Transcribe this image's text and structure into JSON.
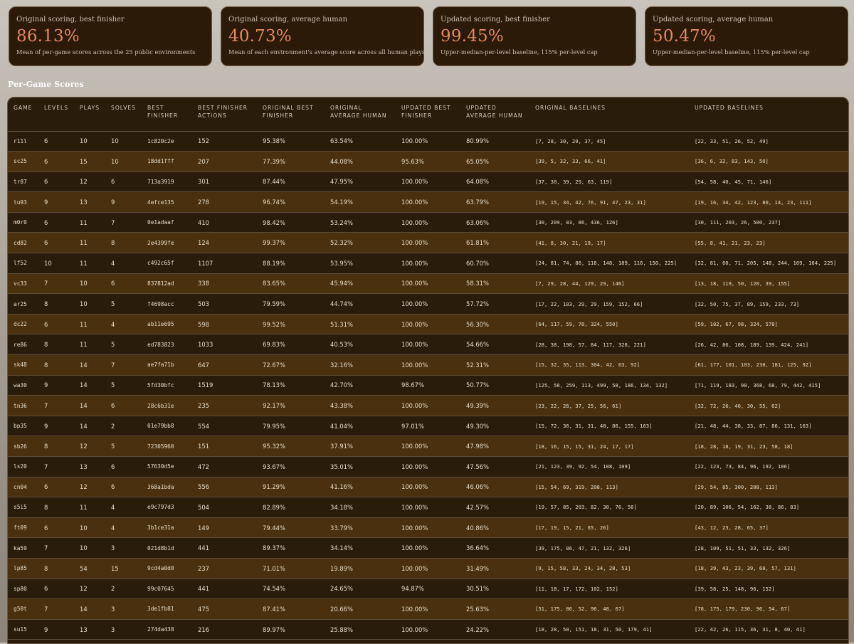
{
  "summary_cards": [
    {
      "label": "Original scoring, best finisher",
      "value": "86.13%",
      "description": "Mean of per-game scores across the 25 public environments"
    },
    {
      "label": "Original scoring, average human",
      "value": "40.73%",
      "description": "Mean of each environment's average score across all human plays"
    },
    {
      "label": "Updated scoring, best finisher",
      "value": "99.45%",
      "description": "Upper-median-per-level baseline, 115% per-level cap"
    },
    {
      "label": "Updated scoring, average human",
      "value": "50.47%",
      "description": "Upper-median-per-level baseline, 115% per-level cap"
    }
  ],
  "section_title": "Per-Game Scores",
  "table": {
    "headers": [
      "GAME",
      "LEVELS",
      "PLAYS",
      "SOLVES",
      "BEST FINISHER",
      "BEST FINISHER ACTIONS",
      "ORIGINAL BEST FINISHER",
      "ORIGINAL AVERAGE HUMAN",
      "UPDATED BEST FINISHER",
      "UPDATED AVERAGE HUMAN",
      "ORIGINAL BASELINES",
      "UPDATED BASELINES"
    ],
    "rows": [
      [
        "r11l",
        "6",
        "10",
        "10",
        "1c820c2e",
        "152",
        "95.38%",
        "63.54%",
        "100.00%",
        "80.99%",
        "[7, 28, 30, 20, 37, 45]",
        "[22, 33, 51, 26, 52, 49]"
      ],
      [
        "sc25",
        "6",
        "15",
        "10",
        "18dd1fff",
        "207",
        "77.39%",
        "44.08%",
        "95.63%",
        "65.05%",
        "[39, 5, 32, 33, 66, 41]",
        "[36, 6, 32, 83, 143, 50]"
      ],
      [
        "tr87",
        "6",
        "12",
        "6",
        "713a3919",
        "301",
        "87.44%",
        "47.95%",
        "100.00%",
        "64.08%",
        "[37, 30, 39, 29, 63, 119]",
        "[54, 58, 40, 45, 71, 146]"
      ],
      [
        "tu93",
        "9",
        "13",
        "9",
        "4efce135",
        "278",
        "96.74%",
        "54.19%",
        "100.00%",
        "63.79%",
        "[19, 15, 34, 42, 76, 91, 47, 23, 31]",
        "[19, 16, 34, 42, 123, 80, 14, 23, 111]"
      ],
      [
        "m0r0",
        "6",
        "11",
        "7",
        "0e1adaaf",
        "410",
        "98.42%",
        "53.24%",
        "100.00%",
        "63.06%",
        "[30, 209, 83, 86, 436, 126]",
        "[30, 111, 203, 26, 500, 237]"
      ],
      [
        "cd82",
        "6",
        "11",
        "8",
        "2e4399fe",
        "124",
        "99.37%",
        "52.32%",
        "100.00%",
        "61.81%",
        "[41, 8, 30, 21, 19, 17]",
        "[55, 8, 41, 21, 23, 23]"
      ],
      [
        "lf52",
        "10",
        "11",
        "4",
        "c492c65f",
        "1107",
        "88.19%",
        "53.95%",
        "100.00%",
        "60.70%",
        "[24, 81, 74, 86, 118, 148, 189, 116, 150, 225]",
        "[32, 81, 60, 71, 205, 148, 244, 109, 164, 225]"
      ],
      [
        "vc33",
        "7",
        "10",
        "6",
        "837812ad",
        "338",
        "83.65%",
        "45.94%",
        "100.00%",
        "58.31%",
        "[7, 29, 28, 44, 129, 29, 146]",
        "[13, 18, 119, 50, 120, 39, 155]"
      ],
      [
        "ar25",
        "8",
        "10",
        "5",
        "f4698acc",
        "503",
        "79.59%",
        "44.74%",
        "100.00%",
        "57.72%",
        "[17, 22, 103, 29, 29, 159, 152, 66]",
        "[32, 50, 75, 37, 89, 159, 233, 73]"
      ],
      [
        "dc22",
        "6",
        "11",
        "4",
        "ab11e695",
        "598",
        "99.52%",
        "51.31%",
        "100.00%",
        "56.30%",
        "[64, 117, 59, 78, 324, 550]",
        "[59, 102, 67, 98, 324, 578]"
      ],
      [
        "re86",
        "8",
        "11",
        "5",
        "ed783823",
        "1033",
        "69.83%",
        "40.53%",
        "100.00%",
        "54.66%",
        "[28, 38, 198, 57, 84, 117, 328, 221]",
        "[26, 42, 86, 108, 189, 139, 424, 241]"
      ],
      [
        "sk48",
        "8",
        "14",
        "7",
        "ae7fa71b",
        "647",
        "72.67%",
        "32.16%",
        "100.00%",
        "52.31%",
        "[15, 32, 35, 113, 304, 42, 63, 92]",
        "[61, 177, 101, 103, 230, 181, 125, 92]"
      ],
      [
        "wa30",
        "9",
        "14",
        "5",
        "5fd30bfc",
        "1519",
        "78.13%",
        "42.70%",
        "98.67%",
        "50.77%",
        "[125, 58, 259, 113, 499, 58, 186, 134, 132]",
        "[71, 119, 183, 98, 368, 68, 79, 442, 415]"
      ],
      [
        "tn36",
        "7",
        "14",
        "6",
        "28c6b31e",
        "235",
        "92.17%",
        "43.38%",
        "100.00%",
        "49.39%",
        "[23, 22, 26, 37, 25, 56, 61]",
        "[32, 72, 26, 40, 30, 55, 62]"
      ],
      [
        "bp35",
        "9",
        "14",
        "2",
        "01e79bb8",
        "554",
        "79.95%",
        "41.04%",
        "97.01%",
        "49.30%",
        "[15, 72, 36, 31, 31, 48, 86, 155, 163]",
        "[21, 48, 44, 38, 33, 87, 86, 131, 163]"
      ],
      [
        "sb26",
        "8",
        "12",
        "5",
        "72305960",
        "151",
        "95.32%",
        "37.91%",
        "100.00%",
        "47.98%",
        "[18, 16, 15, 15, 31, 24, 17, 17]",
        "[18, 28, 18, 19, 31, 23, 58, 18]"
      ],
      [
        "ls20",
        "7",
        "13",
        "6",
        "57630d5e",
        "472",
        "93.67%",
        "35.01%",
        "100.00%",
        "47.56%",
        "[21, 123, 39, 92, 54, 108, 109]",
        "[22, 123, 73, 84, 96, 192, 186]"
      ],
      [
        "cn04",
        "6",
        "12",
        "6",
        "368a1bda",
        "556",
        "91.29%",
        "41.16%",
        "100.00%",
        "46.06%",
        "[15, 54, 69, 319, 208, 113]",
        "[29, 54, 85, 300, 208, 113]"
      ],
      [
        "s5i5",
        "8",
        "11",
        "4",
        "e9c797d3",
        "504",
        "82.89%",
        "34.18%",
        "100.00%",
        "42.57%",
        "[19, 57, 85, 203, 82, 30, 76, 56]",
        "[20, 89, 106, 54, 162, 38, 86, 83]"
      ],
      [
        "ft09",
        "6",
        "10",
        "4",
        "3b1ce31a",
        "149",
        "79.44%",
        "33.79%",
        "100.00%",
        "40.86%",
        "[17, 19, 15, 21, 65, 26]",
        "[43, 12, 23, 28, 65, 37]"
      ],
      [
        "ka59",
        "7",
        "10",
        "3",
        "021d8b1d",
        "441",
        "89.37%",
        "34.14%",
        "100.00%",
        "36.64%",
        "[39, 175, 86, 47, 21, 132, 326]",
        "[28, 109, 51, 51, 33, 132, 326]"
      ],
      [
        "lp85",
        "8",
        "54",
        "15",
        "9cd4a0d0",
        "237",
        "71.01%",
        "19.89%",
        "100.00%",
        "31.49%",
        "[9, 15, 58, 33, 24, 34, 28, 53]",
        "[18, 39, 43, 23, 39, 60, 57, 131]"
      ],
      [
        "sp80",
        "6",
        "12",
        "2",
        "99c07645",
        "441",
        "74.54%",
        "24.65%",
        "94.87%",
        "30.51%",
        "[11, 18, 17, 172, 102, 152]",
        "[39, 58, 25, 148, 96, 152]"
      ],
      [
        "g50t",
        "7",
        "14",
        "3",
        "3de1fb81",
        "475",
        "87.41%",
        "20.66%",
        "100.00%",
        "25.63%",
        "[51, 175, 86, 52, 96, 48, 67]",
        "[78, 175, 179, 230, 96, 54, 67]"
      ],
      [
        "su15",
        "9",
        "13",
        "3",
        "274da438",
        "216",
        "89.97%",
        "25.88%",
        "100.00%",
        "24.22%",
        "[18, 28, 50, 151, 18, 31, 50, 179, 41]",
        "[22, 42, 26, 115, 36, 31, 8, 40, 41]"
      ]
    ]
  }
}
